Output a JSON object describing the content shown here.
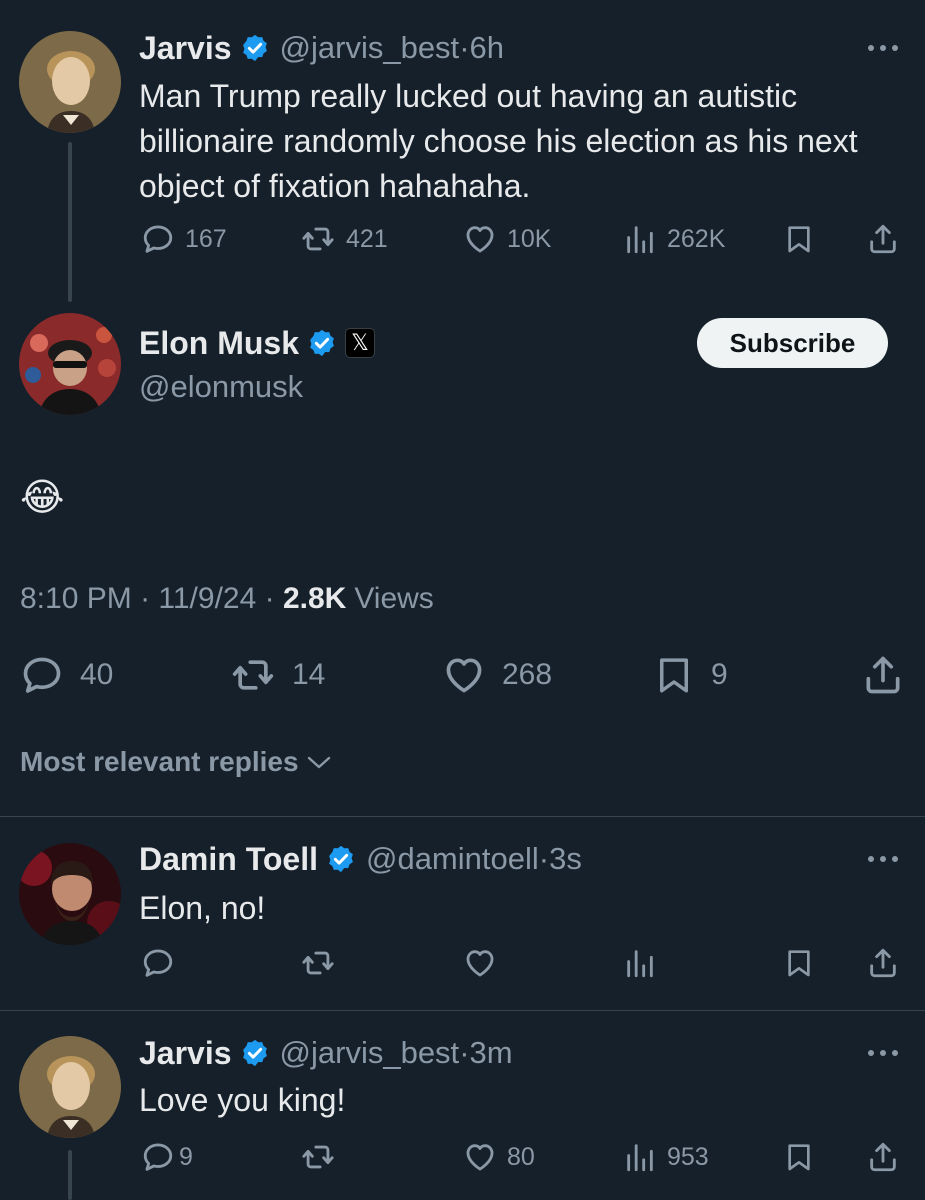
{
  "parent_tweet": {
    "name": "Jarvis",
    "handle": "@jarvis_best",
    "time": "6h",
    "text": "Man Trump really lucked out having an autistic billionaire randomly choose his election as his next object of fixation hahahaha.",
    "replies": "167",
    "retweets": "421",
    "likes": "10K",
    "views": "262K"
  },
  "main_tweet": {
    "name": "Elon Musk",
    "handle": "@elonmusk",
    "subscribe_label": "Subscribe",
    "content": "😂",
    "time": "8:10 PM",
    "date": "11/9/24",
    "views_count": "2.8K",
    "views_label": "Views",
    "replies": "40",
    "retweets": "14",
    "likes": "268",
    "bookmarks": "9"
  },
  "replies_sort": {
    "label": "Most relevant replies"
  },
  "replies": [
    {
      "name": "Damin Toell",
      "handle": "@damintoell",
      "time": "3s",
      "text": "Elon, no!"
    },
    {
      "name": "Jarvis",
      "handle": "@jarvis_best",
      "time": "3m",
      "text": "Love you king!",
      "replies": "9",
      "likes": "80",
      "views": "953"
    }
  ],
  "colors": {
    "background": "#15202b",
    "text": "#e7e9ea",
    "secondary": "#8b98a5",
    "verified": "#1d9bf0",
    "divider": "#38444d"
  }
}
